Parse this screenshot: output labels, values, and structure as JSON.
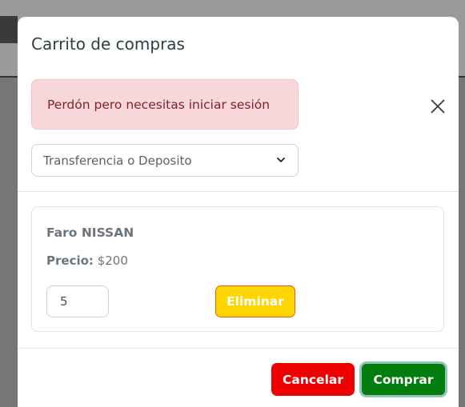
{
  "modal": {
    "title": "Carrito de compras",
    "alert_text": "Perdón pero necesitas iniciar sesión",
    "payment_select": {
      "selected": "Transferencia o Deposito"
    },
    "cart_items": [
      {
        "name": "Faro NISSAN",
        "price_label": "Precio:",
        "price_value": "$200",
        "quantity": "5",
        "delete_label": "Eliminar"
      }
    ],
    "footer": {
      "cancel_label": "Cancelar",
      "buy_label": "Comprar"
    }
  },
  "icons": {
    "close": "close-icon",
    "dropdown": "chevron-down-icon"
  },
  "colors": {
    "alert_bg": "#f8d7da",
    "alert_text": "#842029",
    "delete_button": "#ffd500",
    "cancel_button": "#ee0000",
    "buy_button": "#007d0c"
  }
}
